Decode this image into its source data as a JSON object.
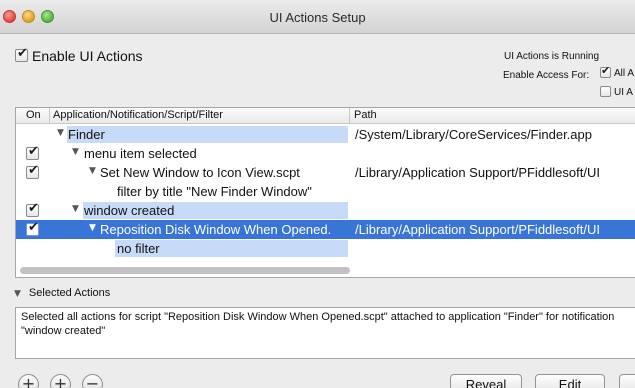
{
  "window": {
    "title": "UI Actions Setup"
  },
  "enable": {
    "label": "Enable UI Actions",
    "checked": true
  },
  "status": {
    "running_text": "UI Actions is Running",
    "access_label": "Enable Access For:",
    "option_all": "All A",
    "option_ui": "UI A"
  },
  "table": {
    "columns": {
      "on": "On",
      "name": "Application/Notification/Script/Filter",
      "path": "Path"
    },
    "rows": [
      {
        "name": "Finder",
        "path": "/System/Library/CoreServices/Finder.app"
      },
      {
        "name": "menu item selected",
        "path": ""
      },
      {
        "name": "Set New Window to Icon View.scpt",
        "path": "/Library/Application Support/PFiddlesoft/UI"
      },
      {
        "name": "filter by title \"New Finder Window\"",
        "path": ""
      },
      {
        "name": "window created",
        "path": ""
      },
      {
        "name": "Reposition Disk Window When Opened.",
        "path": "/Library/Application Support/PFiddlesoft/UI"
      },
      {
        "name": "no filter",
        "path": ""
      }
    ]
  },
  "selected_actions": {
    "header": "Selected Actions",
    "description": "Selected all actions for script \"Reposition Disk Window When Opened.scpt\" attached to application \"Finder\" for notification \"window created\""
  },
  "buttons": {
    "add": "+",
    "add2": "+",
    "remove": "−",
    "reveal": "Reveal",
    "edit": "Edit"
  },
  "colors": {
    "selection": "#3875d7",
    "highlight": "#c7daf7",
    "window_bg": "#ececec"
  }
}
